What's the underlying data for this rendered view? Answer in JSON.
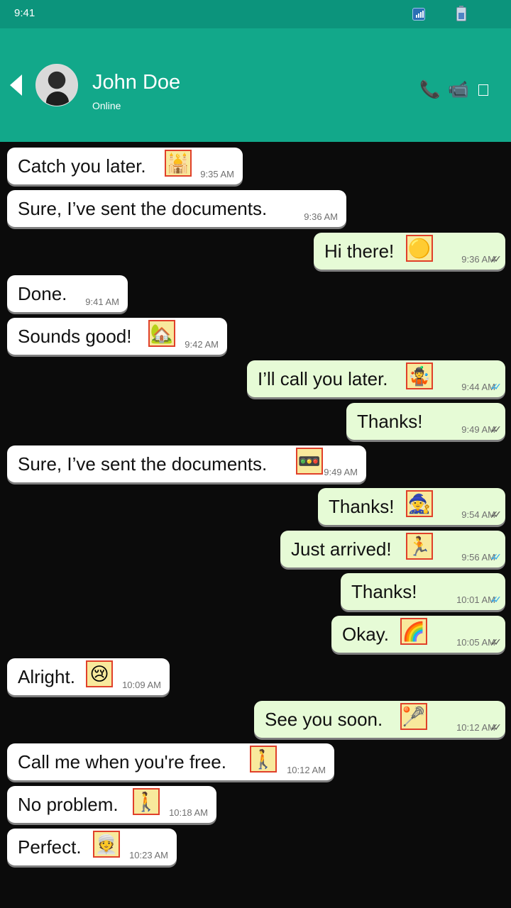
{
  "status_bar": {
    "time": "9:41"
  },
  "header": {
    "contact_name": "John Doe",
    "presence": "Online"
  },
  "messages": [
    {
      "direction": "in",
      "text": "Catch you later.",
      "time": "9:35 AM",
      "emoji_icon": "mosque-icon",
      "emoji": "🕌"
    },
    {
      "direction": "in",
      "text": "Sure, I’ve sent the documents.",
      "time": "9:36 AM",
      "emoji_icon": "",
      "emoji": ""
    },
    {
      "direction": "out",
      "text": "Hi there!",
      "time": "9:36 AM",
      "emoji_icon": "yellow-circle-icon",
      "emoji": "🟡",
      "status": "sent"
    },
    {
      "direction": "in",
      "text": "Done.",
      "time": "9:41 AM",
      "emoji_icon": "",
      "emoji": ""
    },
    {
      "direction": "in",
      "text": "Sounds good!",
      "time": "9:42 AM",
      "emoji_icon": "house-with-garden-icon",
      "emoji": "🏡"
    },
    {
      "direction": "out",
      "text": "I’ll call you later.",
      "time": "9:44 AM",
      "emoji_icon": "person-juggling-icon",
      "emoji": "🤹",
      "status": "read"
    },
    {
      "direction": "out",
      "text": "Thanks!",
      "time": "9:49 AM",
      "emoji_icon": "",
      "emoji": "",
      "status": "sent"
    },
    {
      "direction": "in",
      "text": "Sure, I’ve sent the documents.",
      "time": "9:49 AM",
      "emoji_icon": "traffic-light-icon",
      "emoji": "🚥"
    },
    {
      "direction": "out",
      "text": "Thanks!",
      "time": "9:54 AM",
      "emoji_icon": "mage-icon",
      "emoji": "🧙",
      "status": "sent"
    },
    {
      "direction": "out",
      "text": "Just arrived!",
      "time": "9:56 AM",
      "emoji_icon": "person-running-icon",
      "emoji": "🏃",
      "status": "read"
    },
    {
      "direction": "out",
      "text": "Thanks!",
      "time": "10:01 AM",
      "emoji_icon": "",
      "emoji": "",
      "status": "read"
    },
    {
      "direction": "out",
      "text": "Okay.",
      "time": "10:05 AM",
      "emoji_icon": "rainbow-icon",
      "emoji": "🌈",
      "status": "sent"
    },
    {
      "direction": "in",
      "text": "Alright.",
      "time": "10:09 AM",
      "emoji_icon": "crying-face-icon",
      "emoji": "😢"
    },
    {
      "direction": "out",
      "text": "See you soon.",
      "time": "10:12 AM",
      "emoji_icon": "lacrosse-icon",
      "emoji": "🥍",
      "status": "sent"
    },
    {
      "direction": "in",
      "text": "Call me when you're free.",
      "time": "10:12 AM",
      "emoji_icon": "person-walking-right-icon",
      "emoji": "🚶"
    },
    {
      "direction": "in",
      "text": "No problem.",
      "time": "10:18 AM",
      "emoji_icon": "person-walking-right-icon",
      "emoji": "🚶"
    },
    {
      "direction": "in",
      "text": "Perfect.",
      "time": "10:23 AM",
      "emoji_icon": "person-with-turban-icon",
      "emoji": "👳"
    }
  ]
}
